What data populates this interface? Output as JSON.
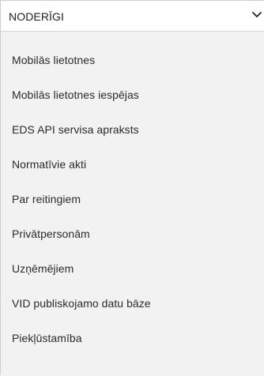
{
  "dropdown": {
    "title": "NODERĪGI",
    "icon": "chevron-down-icon"
  },
  "menu": {
    "items": [
      {
        "label": "Mobilās lietotnes"
      },
      {
        "label": "Mobilās lietotnes iespējas"
      },
      {
        "label": "EDS API servisa apraksts"
      },
      {
        "label": "Normatīvie akti"
      },
      {
        "label": "Par reitingiem"
      },
      {
        "label": "Privātpersonām"
      },
      {
        "label": "Uzņēmējiem"
      },
      {
        "label": "VID publiskojamo datu bāze"
      },
      {
        "label": "Piekļūstamība"
      }
    ]
  },
  "colors": {
    "panel_background": "#f2f2f2",
    "text": "#2b2b2b",
    "border": "#cfcfcf"
  }
}
